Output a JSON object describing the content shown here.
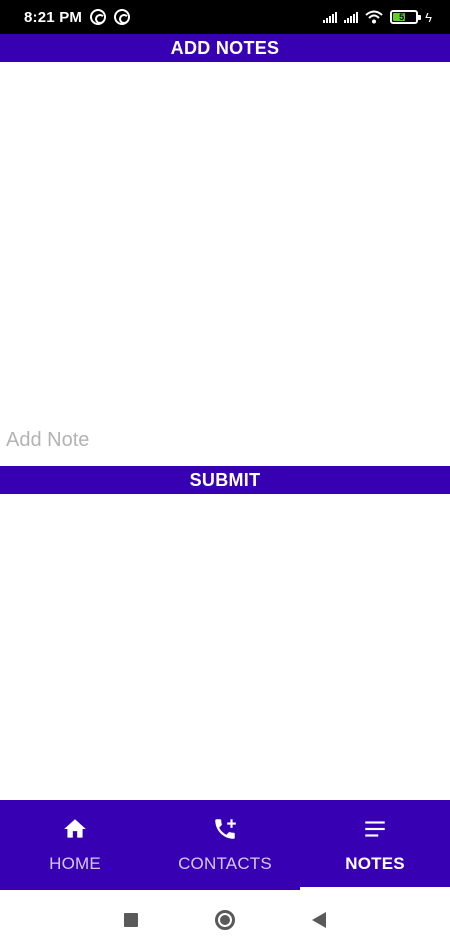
{
  "status_bar": {
    "time": "8:21 PM",
    "battery_level": "51",
    "icons": [
      "notification-icon",
      "notification-icon",
      "signal-icon",
      "signal-icon",
      "wifi-icon",
      "battery-icon",
      "charging-icon"
    ]
  },
  "header": {
    "title": "ADD NOTES"
  },
  "note_input": {
    "value": "",
    "placeholder": "Add Note"
  },
  "submit": {
    "label": "SUBMIT"
  },
  "bottom_nav": {
    "items": [
      {
        "label": "HOME",
        "icon": "home-icon",
        "active": false
      },
      {
        "label": "CONTACTS",
        "icon": "add-call-icon",
        "active": false
      },
      {
        "label": "NOTES",
        "icon": "notes-icon",
        "active": true
      }
    ]
  },
  "system_nav": {
    "buttons": [
      "recents-icon",
      "home-circle-icon",
      "back-icon"
    ]
  },
  "colors": {
    "primary": "#3700b3",
    "status_bar": "#000000",
    "background": "#ffffff",
    "placeholder": "#b3b3b3",
    "battery": "#5fd12e"
  }
}
